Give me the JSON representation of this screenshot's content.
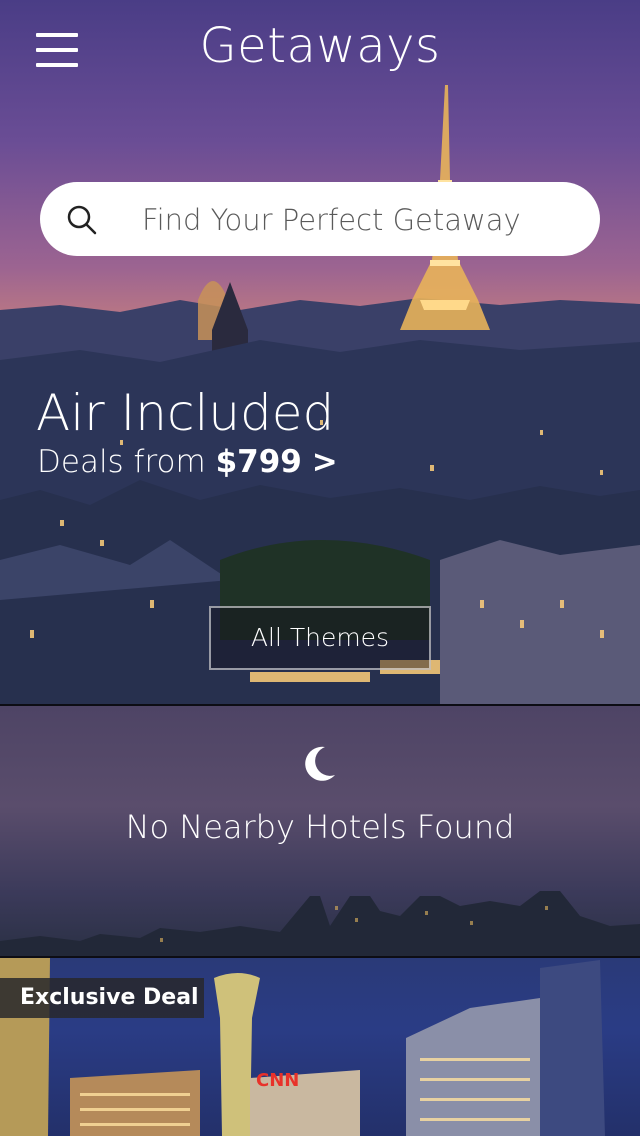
{
  "header": {
    "title": "Getaways",
    "menu_icon": "hamburger-menu-icon"
  },
  "search": {
    "placeholder": "Find Your Perfect Getaway",
    "icon": "search-icon"
  },
  "promo": {
    "title": "Air Included",
    "subtitle_prefix": "Deals from",
    "price": "$799",
    "arrow": ">"
  },
  "themes_button": {
    "label": "All Themes"
  },
  "nearby": {
    "icon": "moon-icon",
    "message": "No Nearby Hotels Found"
  },
  "deal": {
    "badge": "Exclusive Deal",
    "sign_text": "CNN"
  },
  "colors": {
    "sky_top": "#4a3d86",
    "sky_horizon": "#b57486",
    "city": "#253356",
    "search_bg": "#ffffff"
  }
}
